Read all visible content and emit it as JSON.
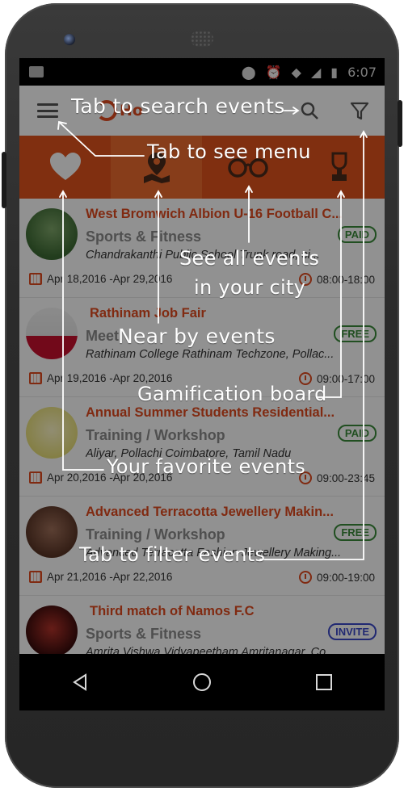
{
  "status": {
    "time": "6:07"
  },
  "toolbar": {
    "logo_text": "Ho"
  },
  "tabs": [
    {
      "name": "favorites",
      "icon": "heart-icon"
    },
    {
      "name": "nearby",
      "icon": "map-pin-icon"
    },
    {
      "name": "city",
      "icon": "glasses-icon"
    },
    {
      "name": "gamification",
      "icon": "trophy-icon"
    }
  ],
  "events": [
    {
      "title": "West Bromwich Albion U-16 Football C...",
      "category": "Sports & Fitness",
      "badge": "PAID",
      "badge_color": "#3a8c3a",
      "location": "Chandrakanthi Public School Trunk road, ci...",
      "dates": "Apr 18,2016 -Apr 29,2016",
      "time": "08:00-18:00"
    },
    {
      "title": "Rathinam Job Fair",
      "category": "Meet",
      "badge": "FREE",
      "badge_color": "#3a8c3a",
      "location": "Rathinam College Rathinam Techzone, Pollac...",
      "dates": "Apr 19,2016 -Apr 20,2016",
      "time": "09:00-17:00"
    },
    {
      "title": "Annual Summer Students Residential...",
      "category": "Training / Workshop",
      "badge": "PAID",
      "badge_color": "#3a8c3a",
      "location": "Aliyar, Pollachi Coimbatore, Tamil Nadu",
      "dates": "Apr 20,2016 -Apr 20,2016",
      "time": "09:00-23:45"
    },
    {
      "title": "Advanced Terracotta Jewellery Makin...",
      "category": "Training / Workshop",
      "badge": "FREE",
      "badge_color": "#3a8c3a",
      "location": "Advanced Terracotta Fashion Jewellery Making...",
      "dates": "Apr 21,2016 -Apr 22,2016",
      "time": "09:00-19:00"
    },
    {
      "title": "Third match of Namos F.C",
      "category": "Sports & Fitness",
      "badge": "INVITE",
      "badge_color": "#3b49c9",
      "location": "Amrita Vishwa Vidyapeetham Amritanagar, Co...",
      "dates": "",
      "time": ""
    }
  ],
  "annotations": {
    "search": "Tab to search events",
    "menu": "Tab to see menu",
    "city": "See all events",
    "city2": "in your city",
    "nearby": "Near by events",
    "gamification": "Gamification board",
    "favorites": "Your favorite events",
    "filter": "Tab to filter events"
  },
  "colors": {
    "brand": "#e2531d",
    "accent_text": "#e24a1f"
  }
}
